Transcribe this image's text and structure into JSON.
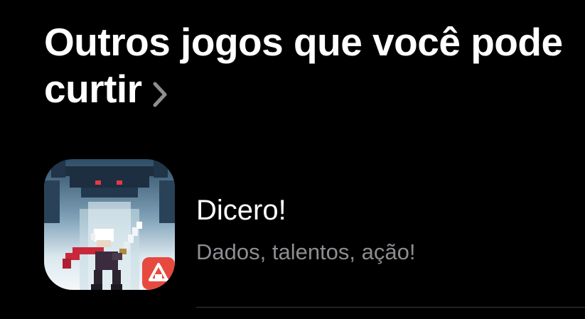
{
  "section": {
    "title": "Outros jogos que você pode curtir",
    "chevron_icon": "chevron-right-icon"
  },
  "app": {
    "name": "Dicero!",
    "subtitle": "Dados, talentos, ação!",
    "icon": "dicero-app-icon",
    "badge_icon": "publisher-badge-icon"
  },
  "colors": {
    "background": "#000000",
    "title_text": "#ffffff",
    "subtitle_text": "#8d8d92",
    "chevron": "#8d8d92",
    "divider": "#38383a",
    "badge": "#e8493f"
  }
}
